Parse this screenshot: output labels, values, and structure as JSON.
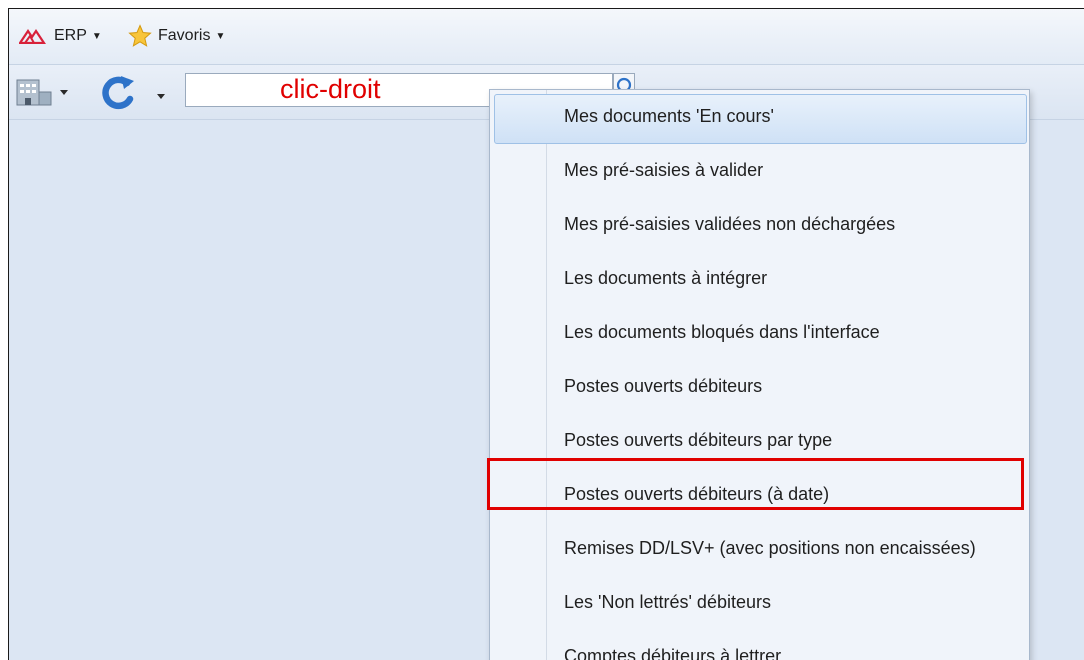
{
  "menubar": {
    "erp_label": "ERP",
    "favoris_label": "Favoris"
  },
  "toolbar": {
    "search_value": "",
    "annotation": "clic-droit"
  },
  "context_menu": {
    "items": [
      {
        "label": "Mes documents 'En cours'"
      },
      {
        "label": "Mes pré-saisies à valider"
      },
      {
        "label": "Mes pré-saisies validées non déchargées"
      },
      {
        "label": "Les documents à intégrer"
      },
      {
        "label": "Les documents bloqués dans l'interface"
      },
      {
        "label": "Postes ouverts débiteurs"
      },
      {
        "label": "Postes ouverts débiteurs par type"
      },
      {
        "label": "Postes ouverts débiteurs (à date)"
      },
      {
        "label": "Remises DD/LSV+ (avec positions non encaissées)"
      },
      {
        "label": "Les 'Non lettrés' débiteurs"
      },
      {
        "label": "Comptes débiteurs à lettrer"
      }
    ]
  },
  "colors": {
    "accent_red": "#e00000",
    "app_background": "#dce6f3",
    "menu_background": "#f0f4fa"
  },
  "icons": [
    "erp-logo-icon",
    "star-icon",
    "building-icon",
    "refresh-icon",
    "search-icon"
  ]
}
